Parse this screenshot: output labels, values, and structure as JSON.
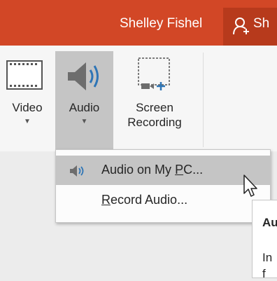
{
  "titlebar": {
    "user_name": "Shelley Fishel",
    "share_label": "Sh",
    "color": "#d24726"
  },
  "ribbon": {
    "video": {
      "label": "Video",
      "icon": "film-icon"
    },
    "audio": {
      "label": "Audio",
      "icon": "speaker-icon"
    },
    "screen_recording": {
      "line1": "Screen",
      "line2": "Recording",
      "icon": "screen-recording-icon"
    }
  },
  "dropdown": {
    "items": [
      {
        "label_pre": "Audio on My ",
        "label_key": "P",
        "label_post": "C...",
        "icon": "speaker-small-icon"
      },
      {
        "label_key": "R",
        "label_post": "ecord Audio..."
      }
    ]
  },
  "tooltip": {
    "title": "Au",
    "body1": "In",
    "body2": "f"
  }
}
